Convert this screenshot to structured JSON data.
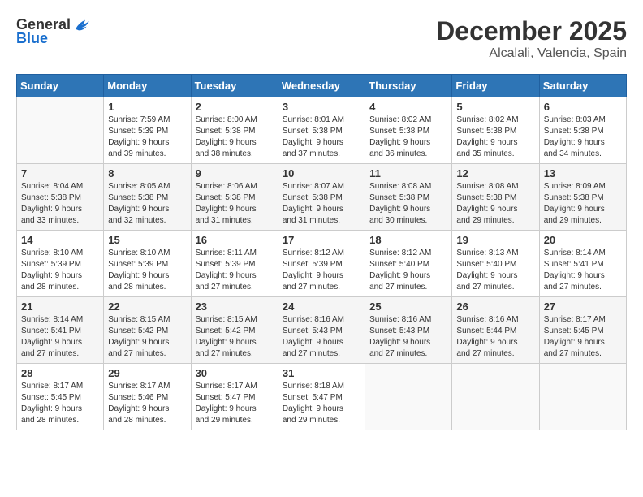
{
  "header": {
    "logo": {
      "general": "General",
      "blue": "Blue"
    },
    "month": "December 2025",
    "location": "Alcalali, Valencia, Spain"
  },
  "weekdays": [
    "Sunday",
    "Monday",
    "Tuesday",
    "Wednesday",
    "Thursday",
    "Friday",
    "Saturday"
  ],
  "weeks": [
    [
      {
        "day": "",
        "info": ""
      },
      {
        "day": "1",
        "info": "Sunrise: 7:59 AM\nSunset: 5:39 PM\nDaylight: 9 hours\nand 39 minutes."
      },
      {
        "day": "2",
        "info": "Sunrise: 8:00 AM\nSunset: 5:38 PM\nDaylight: 9 hours\nand 38 minutes."
      },
      {
        "day": "3",
        "info": "Sunrise: 8:01 AM\nSunset: 5:38 PM\nDaylight: 9 hours\nand 37 minutes."
      },
      {
        "day": "4",
        "info": "Sunrise: 8:02 AM\nSunset: 5:38 PM\nDaylight: 9 hours\nand 36 minutes."
      },
      {
        "day": "5",
        "info": "Sunrise: 8:02 AM\nSunset: 5:38 PM\nDaylight: 9 hours\nand 35 minutes."
      },
      {
        "day": "6",
        "info": "Sunrise: 8:03 AM\nSunset: 5:38 PM\nDaylight: 9 hours\nand 34 minutes."
      }
    ],
    [
      {
        "day": "7",
        "info": "Sunrise: 8:04 AM\nSunset: 5:38 PM\nDaylight: 9 hours\nand 33 minutes."
      },
      {
        "day": "8",
        "info": "Sunrise: 8:05 AM\nSunset: 5:38 PM\nDaylight: 9 hours\nand 32 minutes."
      },
      {
        "day": "9",
        "info": "Sunrise: 8:06 AM\nSunset: 5:38 PM\nDaylight: 9 hours\nand 31 minutes."
      },
      {
        "day": "10",
        "info": "Sunrise: 8:07 AM\nSunset: 5:38 PM\nDaylight: 9 hours\nand 31 minutes."
      },
      {
        "day": "11",
        "info": "Sunrise: 8:08 AM\nSunset: 5:38 PM\nDaylight: 9 hours\nand 30 minutes."
      },
      {
        "day": "12",
        "info": "Sunrise: 8:08 AM\nSunset: 5:38 PM\nDaylight: 9 hours\nand 29 minutes."
      },
      {
        "day": "13",
        "info": "Sunrise: 8:09 AM\nSunset: 5:38 PM\nDaylight: 9 hours\nand 29 minutes."
      }
    ],
    [
      {
        "day": "14",
        "info": "Sunrise: 8:10 AM\nSunset: 5:39 PM\nDaylight: 9 hours\nand 28 minutes."
      },
      {
        "day": "15",
        "info": "Sunrise: 8:10 AM\nSunset: 5:39 PM\nDaylight: 9 hours\nand 28 minutes."
      },
      {
        "day": "16",
        "info": "Sunrise: 8:11 AM\nSunset: 5:39 PM\nDaylight: 9 hours\nand 27 minutes."
      },
      {
        "day": "17",
        "info": "Sunrise: 8:12 AM\nSunset: 5:39 PM\nDaylight: 9 hours\nand 27 minutes."
      },
      {
        "day": "18",
        "info": "Sunrise: 8:12 AM\nSunset: 5:40 PM\nDaylight: 9 hours\nand 27 minutes."
      },
      {
        "day": "19",
        "info": "Sunrise: 8:13 AM\nSunset: 5:40 PM\nDaylight: 9 hours\nand 27 minutes."
      },
      {
        "day": "20",
        "info": "Sunrise: 8:14 AM\nSunset: 5:41 PM\nDaylight: 9 hours\nand 27 minutes."
      }
    ],
    [
      {
        "day": "21",
        "info": "Sunrise: 8:14 AM\nSunset: 5:41 PM\nDaylight: 9 hours\nand 27 minutes."
      },
      {
        "day": "22",
        "info": "Sunrise: 8:15 AM\nSunset: 5:42 PM\nDaylight: 9 hours\nand 27 minutes."
      },
      {
        "day": "23",
        "info": "Sunrise: 8:15 AM\nSunset: 5:42 PM\nDaylight: 9 hours\nand 27 minutes."
      },
      {
        "day": "24",
        "info": "Sunrise: 8:16 AM\nSunset: 5:43 PM\nDaylight: 9 hours\nand 27 minutes."
      },
      {
        "day": "25",
        "info": "Sunrise: 8:16 AM\nSunset: 5:43 PM\nDaylight: 9 hours\nand 27 minutes."
      },
      {
        "day": "26",
        "info": "Sunrise: 8:16 AM\nSunset: 5:44 PM\nDaylight: 9 hours\nand 27 minutes."
      },
      {
        "day": "27",
        "info": "Sunrise: 8:17 AM\nSunset: 5:45 PM\nDaylight: 9 hours\nand 27 minutes."
      }
    ],
    [
      {
        "day": "28",
        "info": "Sunrise: 8:17 AM\nSunset: 5:45 PM\nDaylight: 9 hours\nand 28 minutes."
      },
      {
        "day": "29",
        "info": "Sunrise: 8:17 AM\nSunset: 5:46 PM\nDaylight: 9 hours\nand 28 minutes."
      },
      {
        "day": "30",
        "info": "Sunrise: 8:17 AM\nSunset: 5:47 PM\nDaylight: 9 hours\nand 29 minutes."
      },
      {
        "day": "31",
        "info": "Sunrise: 8:18 AM\nSunset: 5:47 PM\nDaylight: 9 hours\nand 29 minutes."
      },
      {
        "day": "",
        "info": ""
      },
      {
        "day": "",
        "info": ""
      },
      {
        "day": "",
        "info": ""
      }
    ]
  ]
}
